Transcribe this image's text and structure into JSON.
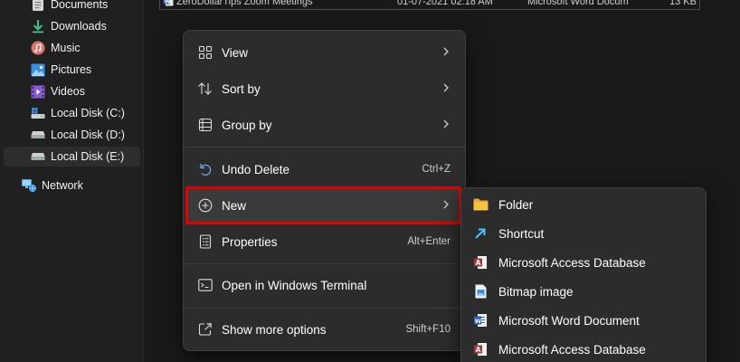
{
  "sidebar": {
    "items": [
      {
        "label": "Documents",
        "icon": "documents-icon"
      },
      {
        "label": "Downloads",
        "icon": "downloads-icon"
      },
      {
        "label": "Music",
        "icon": "music-icon"
      },
      {
        "label": "Pictures",
        "icon": "pictures-icon"
      },
      {
        "label": "Videos",
        "icon": "videos-icon"
      },
      {
        "label": "Local Disk (C:)",
        "icon": "drive-c-icon"
      },
      {
        "label": "Local Disk (D:)",
        "icon": "drive-icon"
      },
      {
        "label": "Local Disk (E:)",
        "icon": "drive-icon"
      },
      {
        "label": "Network",
        "icon": "network-icon"
      }
    ]
  },
  "file_row": {
    "name": "ZeroDollarTips Zoom Meetings",
    "date": "01-07-2021 02:18 AM",
    "type": "Microsoft Word Docum",
    "size": "13 KB"
  },
  "context_menu": {
    "view": "View",
    "sort_by": "Sort by",
    "group_by": "Group by",
    "undo_delete": "Undo Delete",
    "undo_shortcut": "Ctrl+Z",
    "new": "New",
    "properties": "Properties",
    "properties_shortcut": "Alt+Enter",
    "terminal": "Open in Windows Terminal",
    "more_options": "Show more options",
    "more_shortcut": "Shift+F10"
  },
  "new_submenu": {
    "items": [
      {
        "label": "Folder",
        "icon": "folder-icon"
      },
      {
        "label": "Shortcut",
        "icon": "shortcut-icon"
      },
      {
        "label": "Microsoft Access Database",
        "icon": "access-icon"
      },
      {
        "label": "Bitmap image",
        "icon": "bitmap-icon"
      },
      {
        "label": "Microsoft Word Document",
        "icon": "word-icon"
      },
      {
        "label": "Microsoft Access Database",
        "icon": "access-icon"
      }
    ]
  },
  "colors": {
    "highlight_border": "#e30000",
    "folder": "#f5c243",
    "accent": "#4cc2ff"
  }
}
